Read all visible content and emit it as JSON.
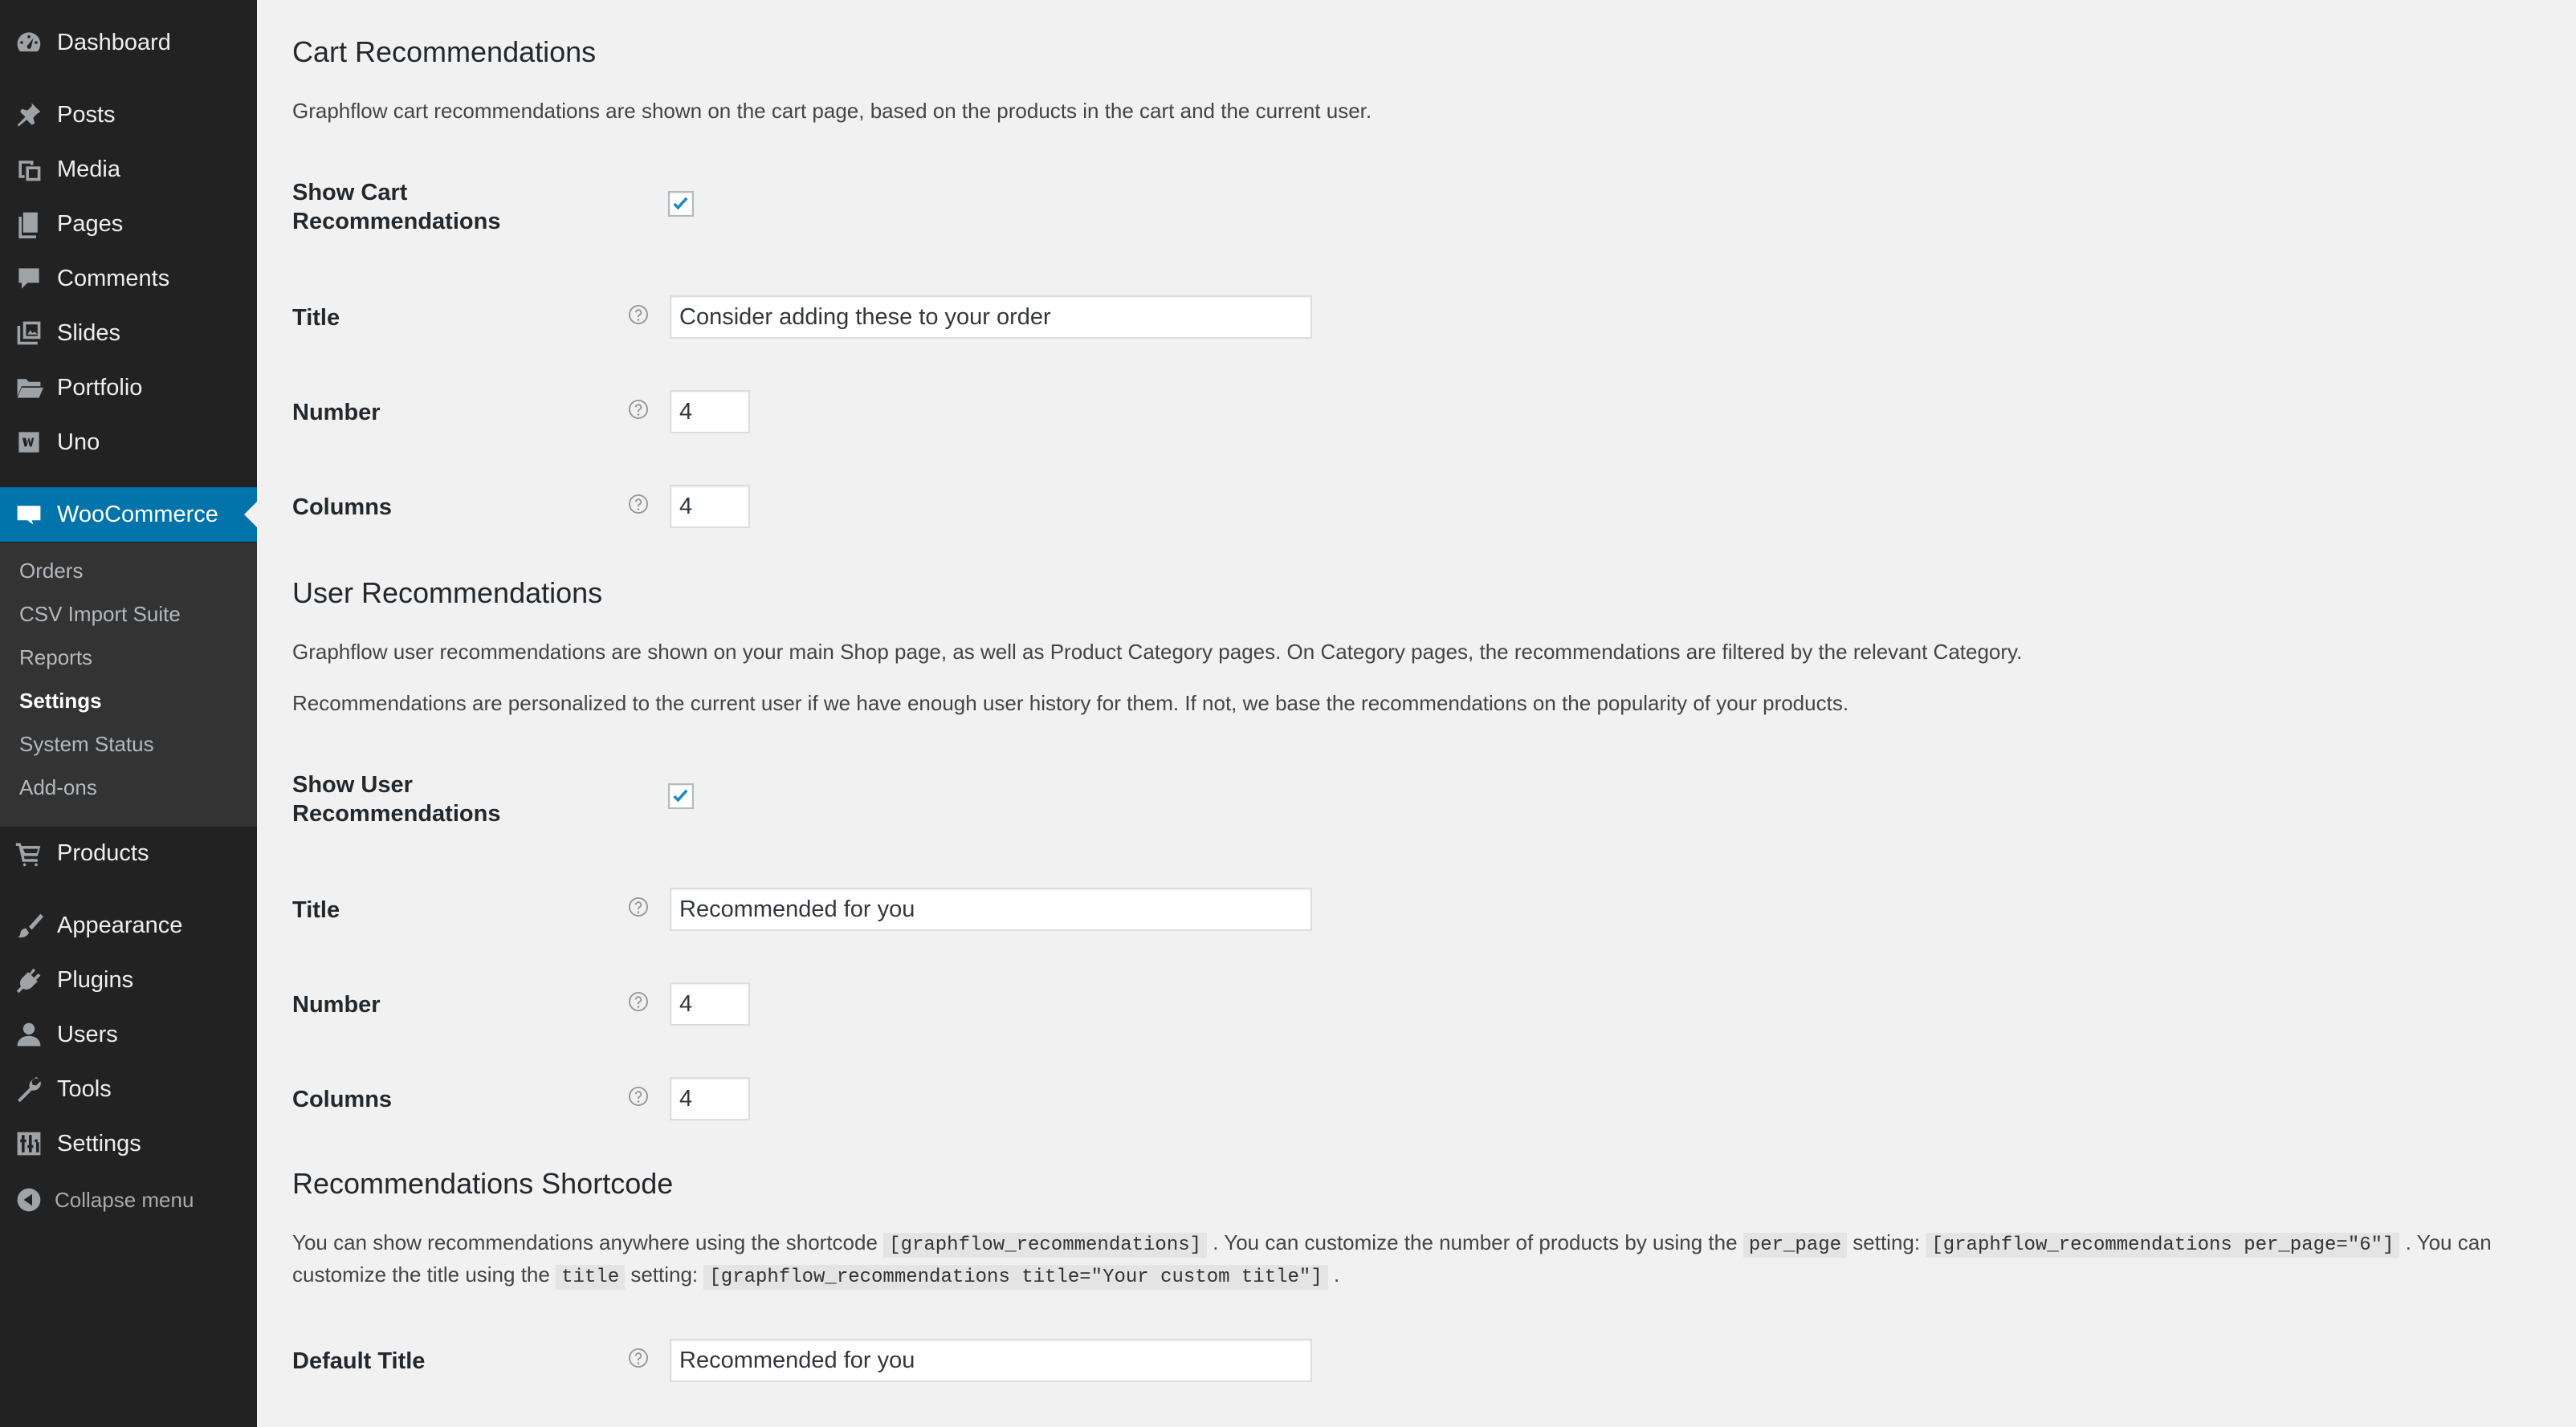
{
  "sidebar": {
    "items": [
      {
        "label": "Dashboard",
        "icon": "dashboard-icon"
      },
      {
        "label": "Posts",
        "icon": "pin-icon"
      },
      {
        "label": "Media",
        "icon": "media-icon"
      },
      {
        "label": "Pages",
        "icon": "pages-icon"
      },
      {
        "label": "Comments",
        "icon": "comment-icon"
      },
      {
        "label": "Slides",
        "icon": "slides-icon"
      },
      {
        "label": "Portfolio",
        "icon": "folder-icon"
      },
      {
        "label": "Uno",
        "icon": "uno-icon"
      },
      {
        "label": "WooCommerce",
        "icon": "woo-icon"
      },
      {
        "label": "Products",
        "icon": "cart-icon"
      },
      {
        "label": "Appearance",
        "icon": "brush-icon"
      },
      {
        "label": "Plugins",
        "icon": "plug-icon"
      },
      {
        "label": "Users",
        "icon": "user-icon"
      },
      {
        "label": "Tools",
        "icon": "wrench-icon"
      },
      {
        "label": "Settings",
        "icon": "sliders-icon"
      }
    ],
    "submenu": [
      "Orders",
      "CSV Import Suite",
      "Reports",
      "Settings",
      "System Status",
      "Add-ons"
    ],
    "collapse_label": "Collapse menu",
    "accent_color": "#0073aa"
  },
  "cart": {
    "heading": "Cart Recommendations",
    "description": "Graphflow cart recommendations are shown on the cart page, based on the products in the cart and the current user.",
    "show_label": "Show Cart Recommendations",
    "show_checked": true,
    "title_label": "Title",
    "title_value": "Consider adding these to your order",
    "number_label": "Number",
    "number_value": "4",
    "columns_label": "Columns",
    "columns_value": "4"
  },
  "user": {
    "heading": "User Recommendations",
    "description1": "Graphflow user recommendations are shown on your main Shop page, as well as Product Category pages. On Category pages, the recommendations are filtered by the relevant Category.",
    "description2": "Recommendations are personalized to the current user if we have enough user history for them. If not, we base the recommendations on the popularity of your products.",
    "show_label": "Show User Recommendations",
    "show_checked": true,
    "title_label": "Title",
    "title_value": "Recommended for you",
    "number_label": "Number",
    "number_value": "4",
    "columns_label": "Columns",
    "columns_value": "4"
  },
  "shortcode": {
    "heading": "Recommendations Shortcode",
    "text1": "You can show recommendations anywhere using the shortcode",
    "code1": "[graphflow_recommendations]",
    "text2": ". You can customize the number of products by using the",
    "code2": "per_page",
    "text3": "setting:",
    "code3": "[graphflow_recommendations per_page=\"6\"]",
    "text4": ". You can",
    "text5": "customize the title using the",
    "code4": "title",
    "text6": "setting:",
    "code5": "[graphflow_recommendations title=\"Your custom title\"]",
    "text7": ".",
    "default_title_label": "Default Title",
    "default_title_value": "Recommended for you"
  }
}
